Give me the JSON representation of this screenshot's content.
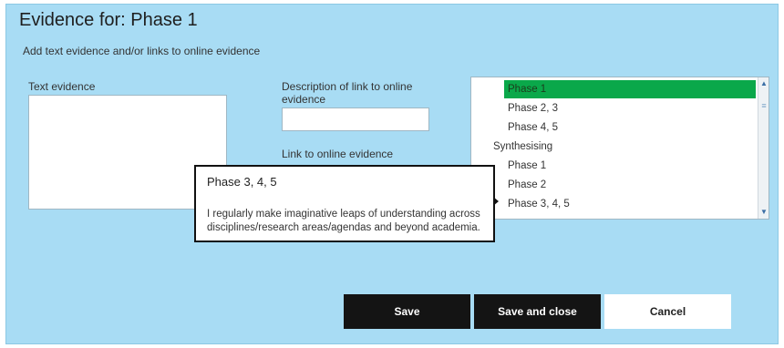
{
  "dialog": {
    "title": "Evidence for: Phase 1",
    "subtitle": "Add text evidence and/or links to online evidence"
  },
  "form": {
    "text_evidence_label": "Text evidence",
    "text_evidence_value": "",
    "link_description_label": "Description of link to online evidence",
    "link_description_value": "",
    "link_label": "Link to online evidence"
  },
  "list": {
    "items": [
      {
        "label": "Phase 1",
        "selected": true
      },
      {
        "label": "Phase 2, 3",
        "selected": false
      },
      {
        "label": "Phase 4, 5",
        "selected": false
      },
      {
        "label": "Synthesising",
        "group": true
      },
      {
        "label": "Phase 1",
        "selected": false
      },
      {
        "label": "Phase 2",
        "selected": false
      },
      {
        "label": "Phase 3, 4, 5",
        "selected": false
      }
    ],
    "selected_color": "#0aa84a"
  },
  "tooltip": {
    "title": "Phase 3, 4, 5",
    "body": "I regularly make imaginative leaps of understanding across disciplines/research areas/agendas and beyond academia."
  },
  "buttons": {
    "save": "Save",
    "save_and_close": "Save and close",
    "cancel": "Cancel"
  },
  "colors": {
    "background": "#a8dcf4",
    "button_dark": "#141414"
  }
}
